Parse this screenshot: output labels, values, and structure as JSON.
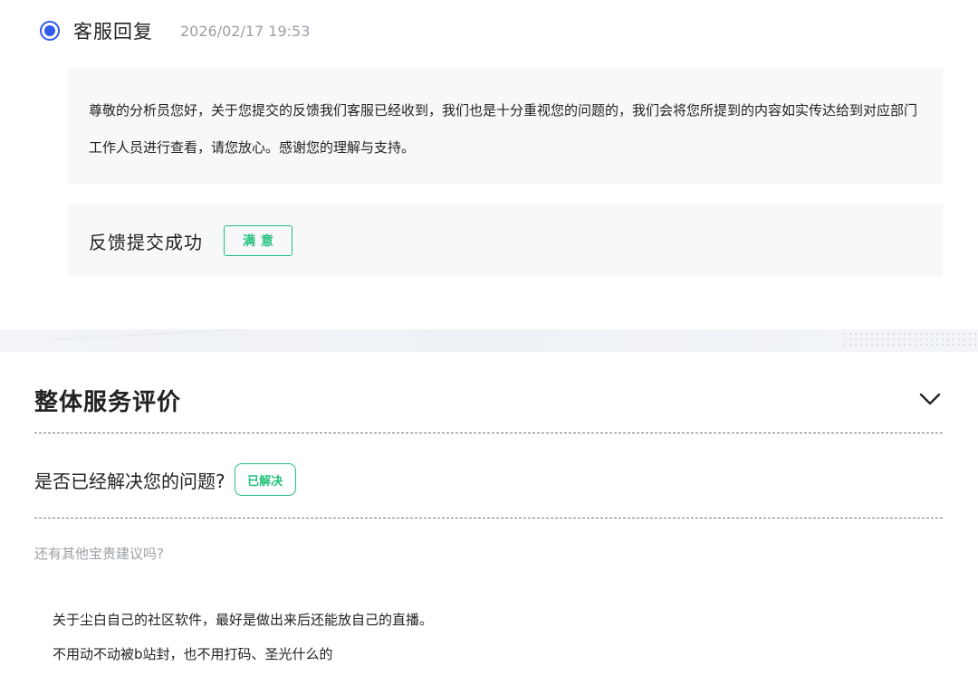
{
  "reply": {
    "title": "客服回复",
    "time": "2026/02/17 19:53",
    "content": "尊敬的分析员您好，关于您提交的反馈我们客服已经收到，我们也是十分重视您的问题的，我们会将您所提到的内容如实传达给到对应部门工作人员进行查看，请您放心。感谢您的理解与支持。"
  },
  "status": {
    "text": "反馈提交成功",
    "tag": "满意"
  },
  "evaluation": {
    "title": "整体服务评价",
    "question": "是否已经解决您的问题?",
    "resolved_tag": "已解决",
    "suggestion_label": "还有其他宝贵建议吗?",
    "suggestion_lines": [
      "关于尘白自己的社区软件，最好是做出来后还能放自己的直播。",
      "不用动不动被b站封，也不用打码、圣光什么的"
    ]
  },
  "colors": {
    "accent_blue": "#2f5bea",
    "success_green": "#22c17b",
    "muted_gray": "#9aa0a6",
    "panel_bg": "#f7f8fa"
  },
  "icons": [
    "radio-selected-icon",
    "chevron-down-icon"
  ]
}
